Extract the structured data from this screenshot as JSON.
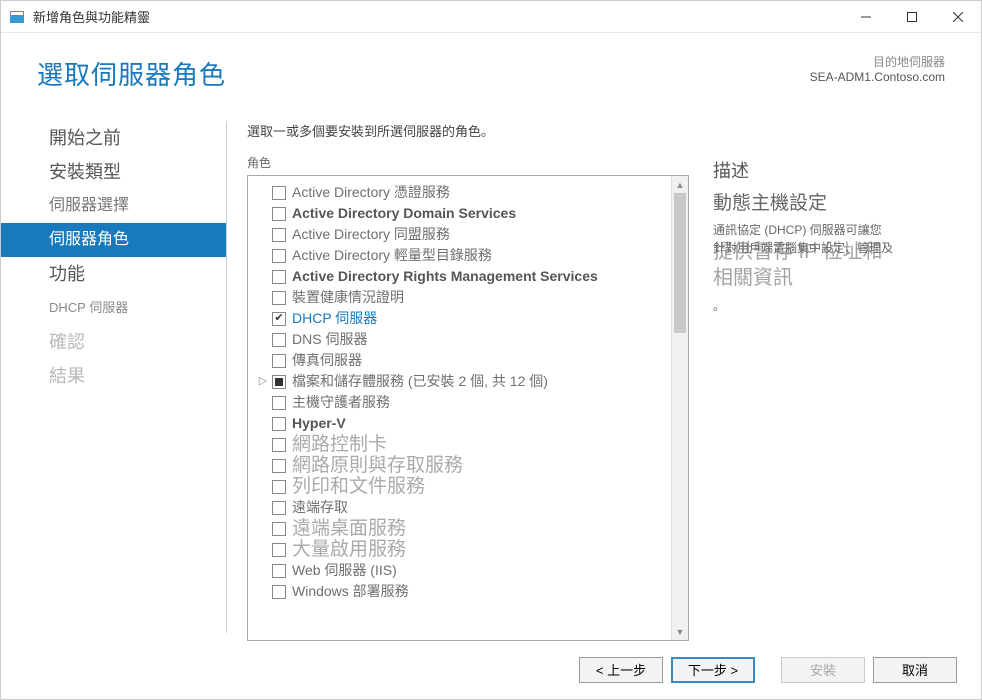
{
  "window": {
    "title": "新增角色與功能精靈"
  },
  "header": {
    "page_title": "選取伺服器角色",
    "dest_label": "目的地伺服器",
    "dest_server": "SEA-ADM1.Contoso.com"
  },
  "sidebar": {
    "steps": [
      {
        "label": "開始之前",
        "cls": "big"
      },
      {
        "label": "安裝類型",
        "cls": "big"
      },
      {
        "label": "伺服器選擇",
        "cls": ""
      },
      {
        "label": "伺服器角色",
        "cls": "active"
      },
      {
        "label": "功能",
        "cls": "big"
      },
      {
        "label": "DHCP 伺服器",
        "cls": "sub"
      },
      {
        "label": "確認",
        "cls": "future"
      },
      {
        "label": "結果",
        "cls": "future"
      }
    ]
  },
  "main": {
    "instruction": "選取一或多個要安裝到所選伺服器的角色。",
    "roles_label": "角色",
    "roles": [
      {
        "label": "Active Directory 憑證服務",
        "state": "unchecked"
      },
      {
        "label": "Active Directory Domain Services",
        "state": "unchecked",
        "bold": true
      },
      {
        "label": "Active Directory 同盟服務",
        "state": "unchecked"
      },
      {
        "label": "Active Directory 輕量型目錄服務",
        "state": "unchecked"
      },
      {
        "label": "Active Directory Rights Management Services",
        "state": "unchecked",
        "bold": true
      },
      {
        "label": "裝置健康情況證明",
        "state": "unchecked"
      },
      {
        "label": "DHCP 伺服器",
        "state": "checked",
        "selected": true
      },
      {
        "label": "DNS 伺服器",
        "state": "unchecked"
      },
      {
        "label": "傳真伺服器",
        "state": "unchecked"
      },
      {
        "label": "檔案和儲存體服務 (已安裝 2 個, 共 12 個)",
        "state": "partial",
        "expand": true
      },
      {
        "label": "主機守護者服務",
        "state": "unchecked"
      },
      {
        "label": "Hyper-V",
        "state": "unchecked",
        "bold": true
      },
      {
        "label": "網路控制卡",
        "state": "unchecked",
        "ghost": true
      },
      {
        "label": "網路原則與存取服務",
        "state": "unchecked",
        "ghost": true
      },
      {
        "label": "列印和文件服務",
        "state": "unchecked",
        "ghost": true
      },
      {
        "label": "遠端存取",
        "state": "unchecked"
      },
      {
        "label": "遠端桌面服務",
        "state": "unchecked",
        "ghost": true
      },
      {
        "label": "大量啟用服務",
        "state": "unchecked",
        "ghost": true
      },
      {
        "label": "Web 伺服器 (IIS)",
        "state": "unchecked"
      },
      {
        "label": "Windows 部署服務",
        "state": "unchecked"
      }
    ]
  },
  "desc": {
    "title": "描述",
    "heading": "動態主機設定",
    "line1": "通訊協定 (DHCP) 伺服器可讓您",
    "line2": "針對用戶端電腦集中設定、管理及",
    "overlay1": "提供暫存 IP 位址和",
    "overlay2": "相關資訊",
    "dot": "。"
  },
  "footer": {
    "prev": "< 上一步",
    "next": "下一步 >",
    "install": "安裝",
    "cancel": "取消"
  }
}
